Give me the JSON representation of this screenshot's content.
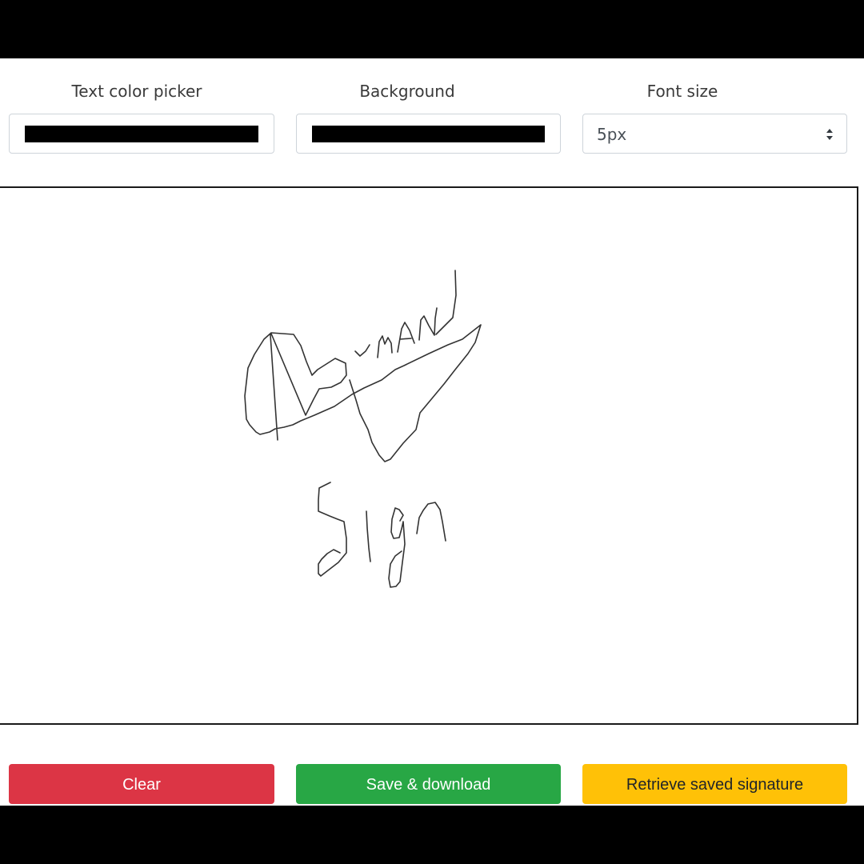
{
  "controls": {
    "text_color_label": "Text color picker",
    "text_color_value": "#000000",
    "background_label": "Background",
    "background_value": "#000000",
    "font_size_label": "Font size",
    "font_size_value": "5px"
  },
  "canvas": {
    "stroke_color": "#000000",
    "signature_text": "NAUMAN Sign"
  },
  "buttons": {
    "clear_label": "Clear",
    "save_label": "Save & download",
    "retrieve_label": "Retrieve saved signature"
  },
  "colors": {
    "clear": "#dc3545",
    "save": "#28a745",
    "retrieve": "#ffc107"
  },
  "icons": {
    "select_arrows": "sort-arrows-icon"
  }
}
